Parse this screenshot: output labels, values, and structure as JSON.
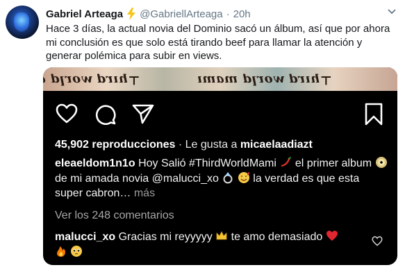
{
  "author": {
    "name": "Gabriel Arteaga",
    "handle": "@GabriellArteaga",
    "separator": "·",
    "time": "20h"
  },
  "tweet_text": "Hace 3 días, la actual novia del Dominio sacó un álbum, así que por ahora mi conclusión es que solo está tirando beef para llamar la atención y generar polémica para subir en views.",
  "embed": {
    "banner_text_left": "ɐ plɹoʍ pɹıɥ⊥",
    "banner_text_right": "ıɯɐɯ plɹoʍ pɹıɥ⊥",
    "views": "45,902 reproducciones",
    "likes_prefix": "· Le gusta a",
    "likes_user": "micaelaadiazt",
    "caption_user": "eleaeldom1n1o",
    "caption_part1": "Hoy Salió #ThirdWorldMami",
    "caption_part2": "el primer album",
    "caption_part3": "de mi amada novia @malucci_xo",
    "caption_part4": "la verdad es que esta super cabron…",
    "more": "más",
    "comments_link": "Ver los 248 comentarios",
    "comment_user": "malucci_xo",
    "comment_text1": "Gracias mi reyyyyy",
    "comment_text2": "te amo demasiado"
  },
  "colors": {
    "verified_bolt": "#f5c518",
    "muted_text": "#657786",
    "embed_bg": "#000000"
  },
  "icons": [
    "lightning-bolt-icon",
    "chevron-down-icon",
    "heart-icon",
    "comment-icon",
    "share-icon",
    "bookmark-icon",
    "chili-icon",
    "cd-icon",
    "ring-icon",
    "smiling-face-hearts-icon",
    "crown-icon",
    "red-heart-icon",
    "fire-icon",
    "pleading-face-icon"
  ]
}
